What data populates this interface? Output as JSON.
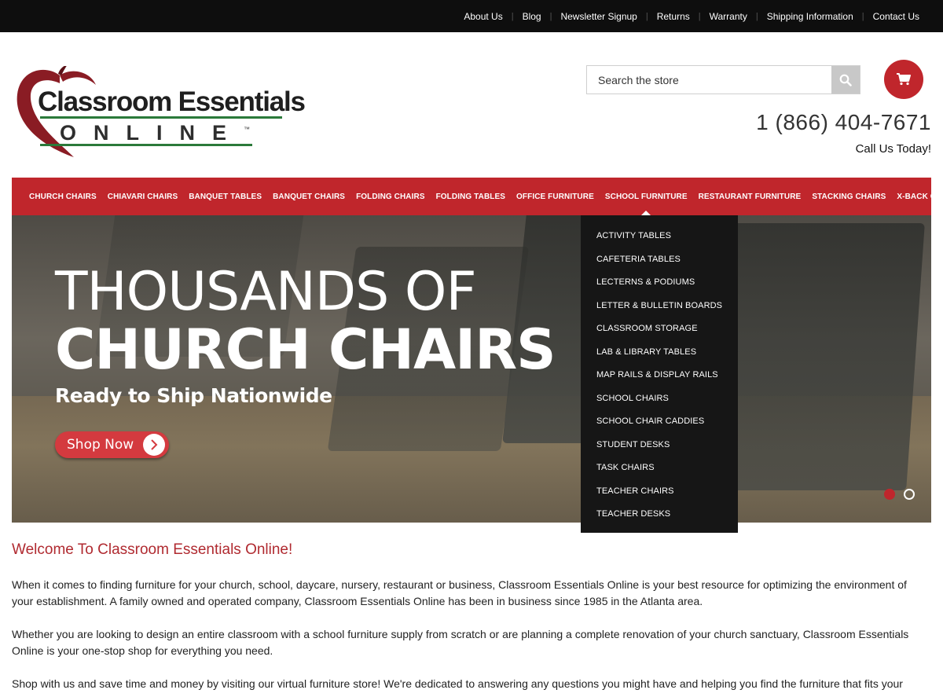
{
  "top_links": [
    "About Us",
    "Blog",
    "Newsletter Signup",
    "Returns",
    "Warranty",
    "Shipping Information",
    "Contact Us"
  ],
  "logo": {
    "line1": "Classroom Essentials",
    "line2": "ONLINE",
    "tm": "™"
  },
  "search": {
    "placeholder": "Search the store"
  },
  "phone": "1 (866) 404-7671",
  "call_us": "Call Us Today!",
  "nav": {
    "items": [
      "Church Chairs",
      "Chiavari Chairs",
      "Banquet Tables",
      "Banquet Chairs",
      "Folding Chairs",
      "Folding Tables",
      "Office Furniture",
      "School Furniture",
      "Restaurant Furniture",
      "Stacking Chairs",
      "X-Back Chairs"
    ],
    "active": "School Furniture"
  },
  "dropdown": {
    "items": [
      "Activity Tables",
      "Cafeteria Tables",
      "Lecterns & Podiums",
      "Letter & Bulletin Boards",
      "Classroom Storage",
      "Lab & Library Tables",
      "Map Rails & Display Rails",
      "School Chairs",
      "School Chair Caddies",
      "Student Desks",
      "Task Chairs",
      "Teacher Chairs",
      "Teacher Desks"
    ]
  },
  "hero": {
    "title_line1": "THOUSANDS OF",
    "title_line2": "CHURCH CHAIRS",
    "subtitle": "Ready to Ship Nationwide",
    "button": "Shop Now",
    "slides": 2,
    "active_slide": 1
  },
  "content": {
    "heading": "Welcome To Classroom Essentials Online!",
    "paragraphs": [
      "When it comes to finding furniture for your church, school, daycare, nursery, restaurant or business, Classroom Essentials Online is your best resource for optimizing the environment of your establishment. A family owned and operated company, Classroom Essentials Online has been in business since 1985 in the Atlanta area.",
      "Whether you are looking to design an entire classroom with a school furniture supply from scratch or are planning a complete renovation of your church sanctuary, Classroom Essentials Online is your one-stop shop for everything you need.",
      "Shop with us and save time and money by visiting our virtual furniture store! We're dedicated to answering any questions you might have and helping you find the furniture that fits your"
    ]
  },
  "colors": {
    "brand_red": "#c0262c",
    "topbar": "#0e0e0e",
    "dropdown_bg": "#161616"
  }
}
